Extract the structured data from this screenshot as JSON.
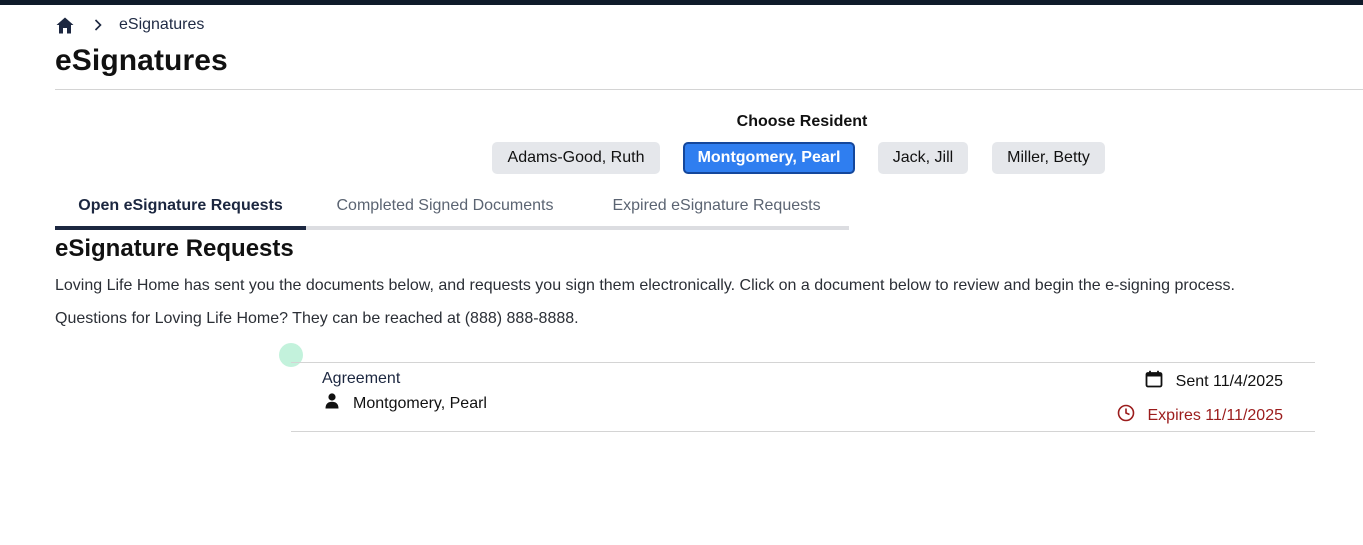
{
  "breadcrumb": {
    "current": "eSignatures"
  },
  "page": {
    "title": "eSignatures"
  },
  "resident_picker": {
    "label": "Choose Resident",
    "residents": [
      {
        "name": "Adams-Good, Ruth",
        "selected": false
      },
      {
        "name": "Montgomery, Pearl",
        "selected": true
      },
      {
        "name": "Jack, Jill",
        "selected": false
      },
      {
        "name": "Miller, Betty",
        "selected": false
      }
    ]
  },
  "tabs": [
    {
      "label": "Open eSignature Requests",
      "active": true
    },
    {
      "label": "Completed Signed Documents",
      "active": false
    },
    {
      "label": "Expired eSignature Requests",
      "active": false
    }
  ],
  "requests": {
    "title": "eSignature Requests",
    "description": "Loving Life Home has sent you the documents below, and requests you sign them electronically. Click on a document below to review and begin the e-signing process.",
    "contact": "Questions for Loving Life Home? They can be reached at (888) 888-8888.",
    "items": [
      {
        "document": "Agreement",
        "resident": "Montgomery, Pearl",
        "sent": "Sent 11/4/2025",
        "expires": "Expires 11/11/2025"
      }
    ]
  },
  "colors": {
    "accent": "#2f7ef0",
    "accent_border": "#14479c",
    "tab_active": "#1c2740",
    "expiry_red": "#9b1c1c",
    "top_bar": "#0f1b2a"
  },
  "icons": {
    "home": "home-icon",
    "separator": "chevron-right-icon",
    "person": "person-icon",
    "calendar": "calendar-icon",
    "clock": "clock-icon"
  }
}
